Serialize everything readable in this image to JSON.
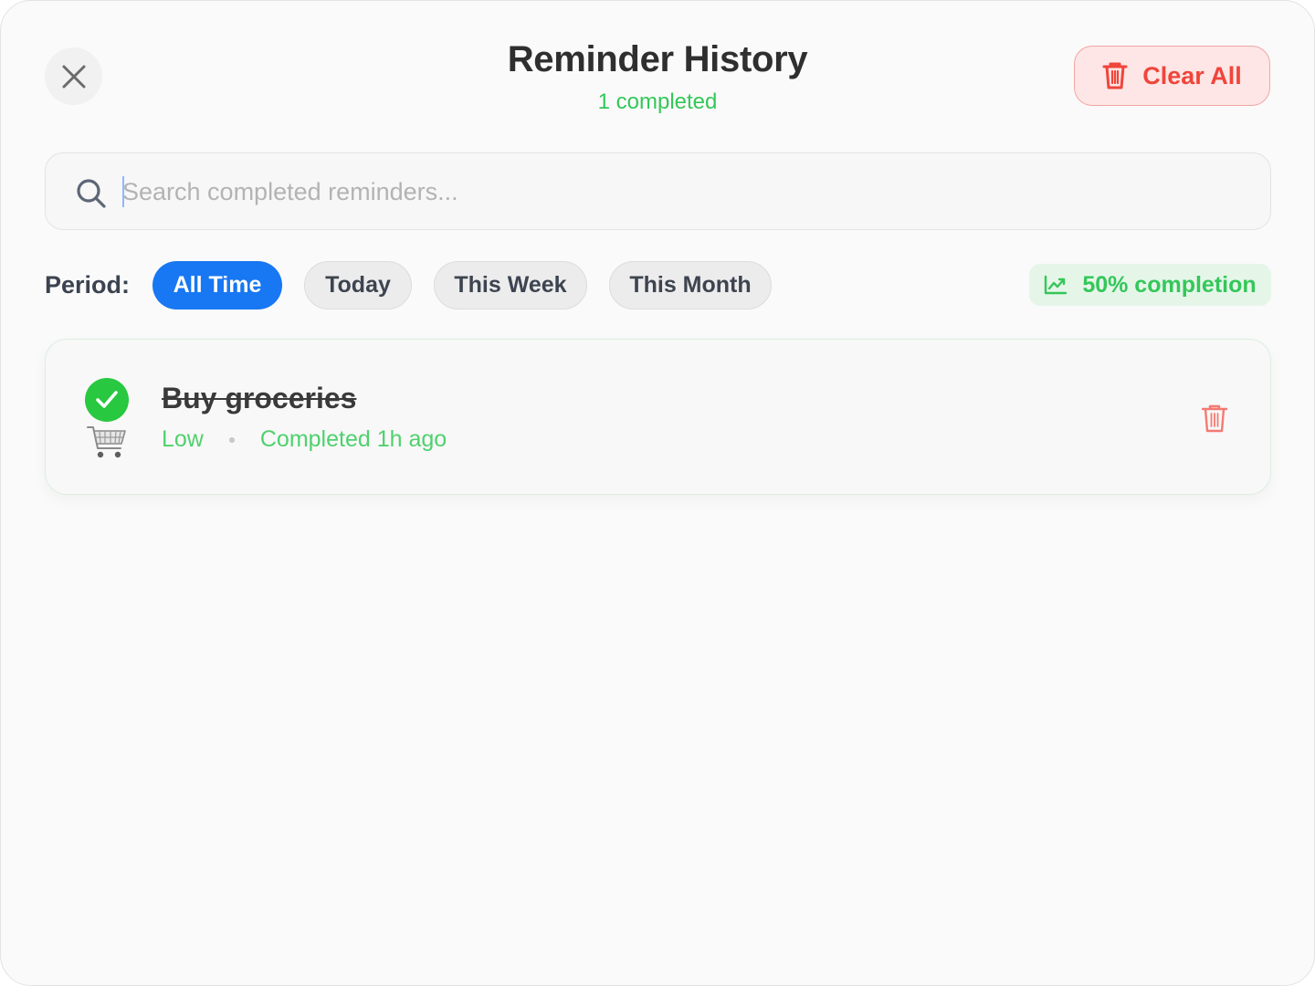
{
  "header": {
    "title": "Reminder History",
    "subtitle": "1 completed",
    "clear_label": "Clear All"
  },
  "search": {
    "placeholder": "Search completed reminders...",
    "value": ""
  },
  "filters": {
    "label": "Period:",
    "options": [
      {
        "label": "All Time",
        "active": true
      },
      {
        "label": "Today",
        "active": false
      },
      {
        "label": "This Week",
        "active": false
      },
      {
        "label": "This Month",
        "active": false
      }
    ]
  },
  "completion": {
    "label": "50% completion",
    "percent": 50
  },
  "reminders": [
    {
      "title": "Buy groceries",
      "priority": "Low",
      "completed": "Completed 1h ago",
      "icon": "shopping-cart-icon",
      "done": true
    }
  ],
  "colors": {
    "accent": "#1877f2",
    "success": "#34c759",
    "danger": "#f0453b"
  }
}
